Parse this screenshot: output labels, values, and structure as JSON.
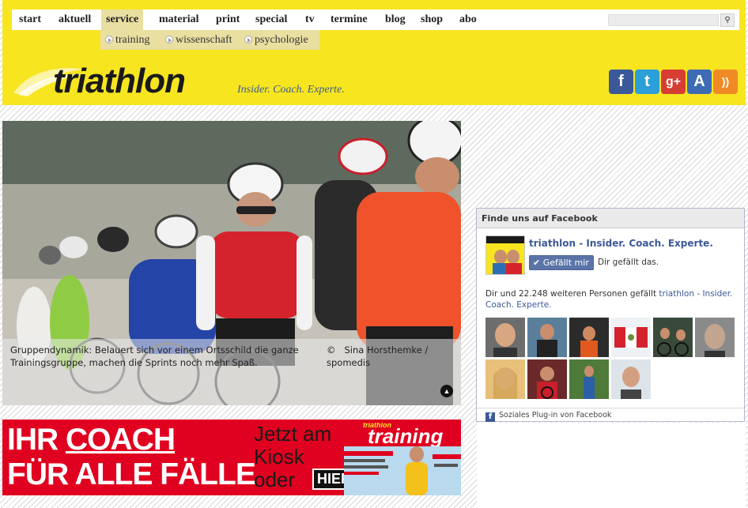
{
  "nav": {
    "items": [
      {
        "label": "start"
      },
      {
        "label": "aktuell"
      },
      {
        "label": "service"
      },
      {
        "label": "material"
      },
      {
        "label": "print"
      },
      {
        "label": "special"
      },
      {
        "label": "tv"
      },
      {
        "label": "termine"
      },
      {
        "label": "blog"
      },
      {
        "label": "shop"
      },
      {
        "label": "abo"
      }
    ],
    "active": "service",
    "search_placeholder": "",
    "search_icon": "magnifier-icon"
  },
  "subnav": {
    "items": [
      {
        "label": "training"
      },
      {
        "label": "wissenschaft"
      },
      {
        "label": "psychologie"
      }
    ]
  },
  "brand": {
    "logo_text": "triathlon",
    "tagline": "Insider. Coach. Experte.",
    "colors": {
      "header": "#f7e520",
      "tagline": "#3a5c8c"
    }
  },
  "social": [
    {
      "name": "facebook-icon",
      "glyph": "f",
      "color": "#3b5998"
    },
    {
      "name": "twitter-icon",
      "glyph": "t",
      "color": "#2c9fd8"
    },
    {
      "name": "googleplus-icon",
      "glyph": "g+",
      "color": "#d73d32"
    },
    {
      "name": "appstore-icon",
      "glyph": "A",
      "color": "#3d6cb5"
    },
    {
      "name": "rss-icon",
      "glyph": "))",
      "color": "#f08a24"
    }
  ],
  "hero": {
    "caption": "Gruppendynamik: Belauert sich vor einem Ortsschild die ganze Trainingsgruppe, machen die Sprints noch mehr Spaß.",
    "credit_symbol": "©",
    "credit": "Sina Horsthemke / spomedis",
    "toggle_glyph": "▲"
  },
  "ad": {
    "line1_pre": "IHR ",
    "line1_u": "COACH",
    "line2": "FÜR ALLE FÄLLE",
    "kiosk": "Jetzt am Kiosk oder",
    "hier": "HIER!",
    "magazine_title": "training",
    "magazine_label": "triathlon"
  },
  "facebook": {
    "header": "Finde uns auf Facebook",
    "page_name": "triathlon - Insider. Coach. Experte.",
    "like_label": "Gefällt mir",
    "like_status": "Dir gefällt das.",
    "count_text": "Dir und 22.248 weiteren Personen gefällt ",
    "count_link": "triathlon - Insider. Coach. Experte.",
    "footer": "Soziales Plug-in von Facebook"
  }
}
